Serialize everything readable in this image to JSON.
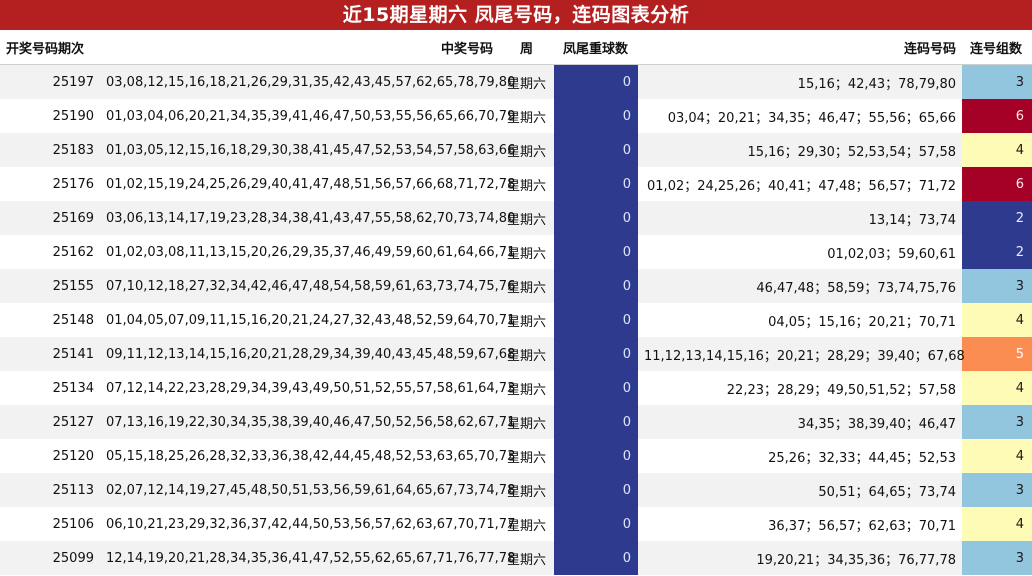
{
  "title": "近15期星期六 凤尾号码，连码图表分析",
  "columns": [
    "开奖号码期次",
    "中奖号码",
    "周",
    "凤尾重球数",
    "连码号码",
    "连号组数"
  ],
  "count_colors": {
    "2": "#2e3a8e",
    "3": "#92c5de",
    "4": "#fdfbb6",
    "5": "#fb8c52",
    "6": "#a50026"
  },
  "count_text_colors": {
    "2": "#e8ecff",
    "3": "#1a1a1a",
    "4": "#1a1a1a",
    "5": "#ffffff",
    "6": "#ffe8e8"
  },
  "chart_data": {
    "type": "table",
    "title": "近15期星期六 凤尾号码，连码图表分析",
    "columns": [
      "开奖号码期次",
      "中奖号码",
      "周",
      "凤尾重球数",
      "连码号码",
      "连号组数"
    ],
    "rows": [
      {
        "issue": "25197",
        "numbers": "03,08,12,15,16,18,21,26,29,31,35,42,43,45,57,62,65,78,79,80",
        "weekday": "星期六",
        "repeat": 0,
        "consecutive": "15,16；42,43；78,79,80",
        "groups": 3
      },
      {
        "issue": "25190",
        "numbers": "01,03,04,06,20,21,34,35,39,41,46,47,50,53,55,56,65,66,70,79",
        "weekday": "星期六",
        "repeat": 0,
        "consecutive": "03,04；20,21；34,35；46,47；55,56；65,66",
        "groups": 6
      },
      {
        "issue": "25183",
        "numbers": "01,03,05,12,15,16,18,29,30,38,41,45,47,52,53,54,57,58,63,66",
        "weekday": "星期六",
        "repeat": 0,
        "consecutive": "15,16；29,30；52,53,54；57,58",
        "groups": 4
      },
      {
        "issue": "25176",
        "numbers": "01,02,15,19,24,25,26,29,40,41,47,48,51,56,57,66,68,71,72,78",
        "weekday": "星期六",
        "repeat": 0,
        "consecutive": "01,02；24,25,26；40,41；47,48；56,57；71,72",
        "groups": 6
      },
      {
        "issue": "25169",
        "numbers": "03,06,13,14,17,19,23,28,34,38,41,43,47,55,58,62,70,73,74,80",
        "weekday": "星期六",
        "repeat": 0,
        "consecutive": "13,14；73,74",
        "groups": 2
      },
      {
        "issue": "25162",
        "numbers": "01,02,03,08,11,13,15,20,26,29,35,37,46,49,59,60,61,64,66,71",
        "weekday": "星期六",
        "repeat": 0,
        "consecutive": "01,02,03；59,60,61",
        "groups": 2
      },
      {
        "issue": "25155",
        "numbers": "07,10,12,18,27,32,34,42,46,47,48,54,58,59,61,63,73,74,75,76",
        "weekday": "星期六",
        "repeat": 0,
        "consecutive": "46,47,48；58,59；73,74,75,76",
        "groups": 3
      },
      {
        "issue": "25148",
        "numbers": "01,04,05,07,09,11,15,16,20,21,24,27,32,43,48,52,59,64,70,71",
        "weekday": "星期六",
        "repeat": 0,
        "consecutive": "04,05；15,16；20,21；70,71",
        "groups": 4
      },
      {
        "issue": "25141",
        "numbers": "09,11,12,13,14,15,16,20,21,28,29,34,39,40,43,45,48,59,67,68",
        "weekday": "星期六",
        "repeat": 0,
        "consecutive": "11,12,13,14,15,16；20,21；28,29；39,40；67,68",
        "groups": 5
      },
      {
        "issue": "25134",
        "numbers": "07,12,14,22,23,28,29,34,39,43,49,50,51,52,55,57,58,61,64,73",
        "weekday": "星期六",
        "repeat": 0,
        "consecutive": "22,23；28,29；49,50,51,52；57,58",
        "groups": 4
      },
      {
        "issue": "25127",
        "numbers": "07,13,16,19,22,30,34,35,38,39,40,46,47,50,52,56,58,62,67,71",
        "weekday": "星期六",
        "repeat": 0,
        "consecutive": "34,35；38,39,40；46,47",
        "groups": 3
      },
      {
        "issue": "25120",
        "numbers": "05,15,18,25,26,28,32,33,36,38,42,44,45,48,52,53,63,65,70,73",
        "weekday": "星期六",
        "repeat": 0,
        "consecutive": "25,26；32,33；44,45；52,53",
        "groups": 4
      },
      {
        "issue": "25113",
        "numbers": "02,07,12,14,19,27,45,48,50,51,53,56,59,61,64,65,67,73,74,78",
        "weekday": "星期六",
        "repeat": 0,
        "consecutive": "50,51；64,65；73,74",
        "groups": 3
      },
      {
        "issue": "25106",
        "numbers": "06,10,21,23,29,32,36,37,42,44,50,53,56,57,62,63,67,70,71,77",
        "weekday": "星期六",
        "repeat": 0,
        "consecutive": "36,37；56,57；62,63；70,71",
        "groups": 4
      },
      {
        "issue": "25099",
        "numbers": "12,14,19,20,21,28,34,35,36,41,47,52,55,62,65,67,71,76,77,78",
        "weekday": "星期六",
        "repeat": 0,
        "consecutive": "19,20,21；34,35,36；76,77,78",
        "groups": 3
      }
    ]
  }
}
